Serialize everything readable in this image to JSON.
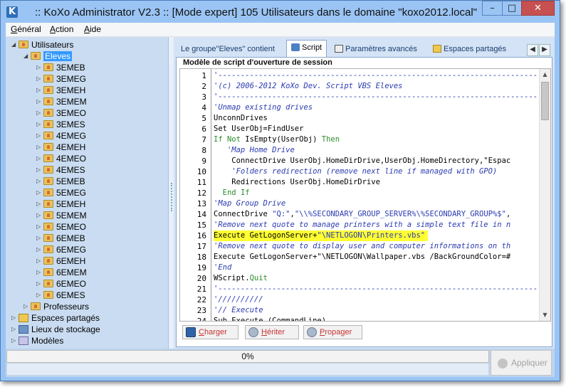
{
  "window": {
    "title": ":: KoXo Administrator V2.3 :: [Mode expert] 105 Utilisateurs dans le domaine \"koxo2012.local\"",
    "app_icon": "K",
    "controls": {
      "minimize": "–",
      "maximize": "□",
      "close": "✕"
    }
  },
  "menu": {
    "items": [
      {
        "accel": "G",
        "rest": "énéral"
      },
      {
        "accel": "A",
        "rest": "ction"
      },
      {
        "accel": "A",
        "rest": "ide"
      }
    ]
  },
  "tree": {
    "root": "Utilisateurs",
    "selected": "Eleves",
    "groups": [
      "3EMEB",
      "3EMEG",
      "3EMEH",
      "3EMEM",
      "3EMEO",
      "3EMES",
      "4EMEG",
      "4EMEH",
      "4EMEO",
      "4EMES",
      "5EMEB",
      "5EMEG",
      "5EMEH",
      "5EMEM",
      "5EMEO",
      "6EMEB",
      "6EMEG",
      "6EMEH",
      "6EMEM",
      "6EMEO",
      "6EMES"
    ],
    "professeurs": "Professeurs",
    "others": [
      "Espaces partagés",
      "Lieux de stockage",
      "Modèles"
    ]
  },
  "tabs": {
    "items": [
      "Le groupe\"Eleves\" contient",
      "Script",
      "Paramètres avancés",
      "Espaces partagés"
    ],
    "active": "Script",
    "scroll_left": "◀",
    "scroll_right": "▶"
  },
  "editor": {
    "section_title": "Modèle de script d'ouverture de session",
    "highlight_line": 16,
    "lines": [
      "'-----------------------------------------------------------------------",
      "'(c) 2006-2012 KoXo Dev. Script VBS Eleves",
      "'-----------------------------------------------------------------------",
      "'Unmap existing drives",
      "UnconnDrives",
      "Set UserObj=FindUser",
      "If Not IsEmpty(UserObj) Then",
      "   'Map Home Drive",
      "    ConnectDrive UserObj.HomeDirDrive,UserObj.HomeDirectory,\"Espac",
      "    'Folders redirection (remove next line if managed with GPO)",
      "    Redirections UserObj.HomeDirDrive",
      "  End If",
      "'Map Group Drive",
      "ConnectDrive \"Q:\",\"\\\\%SECONDARY_GROUP_SERVER%\\%SECONDARY_GROUP%$\",",
      "'Remove next quote to manage printers with a simple text file in n",
      "Execute GetLogonServer+\"\\NETLOGON\\Printers.vbs\"",
      "'Remove next quote to display user and computer informations on th",
      "Execute GetLogonServer+\"\\NETLOGON\\Wallpaper.vbs /BackGroundColor=#",
      "'End",
      "WScript.Quit",
      "'-----------------------------------------------------------------------",
      "'//////////",
      "'// Execute",
      "Sub Execute (CommandLine)"
    ],
    "buttons": [
      {
        "accel": "C",
        "rest": "harger"
      },
      {
        "accel": "H",
        "rest": "ériter"
      },
      {
        "accel": "P",
        "rest": "ropager"
      }
    ]
  },
  "status": {
    "progress_text": "0%",
    "progress_value": 0,
    "apply_label": "Appliquer"
  },
  "colors": {
    "title_bg": "#9ac4f4",
    "close_bg": "#c75050",
    "tree_bg": "#c9dcf1",
    "selection": "#3399ff",
    "highlight": "#ffff33",
    "comment": "#2a3bb0",
    "keyword": "#2c8c2c"
  }
}
